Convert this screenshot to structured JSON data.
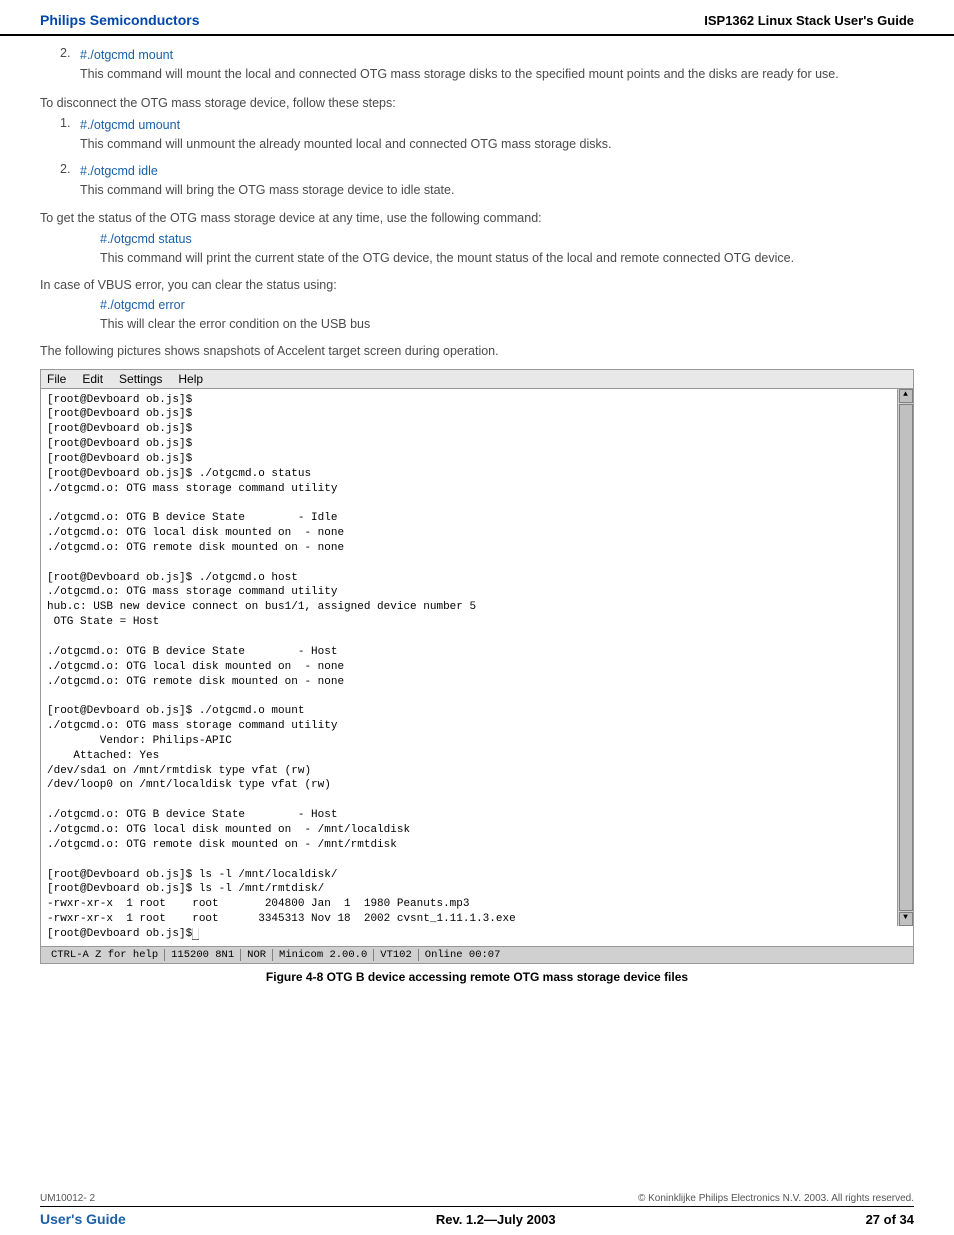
{
  "header": {
    "left": "Philips Semiconductors",
    "right": "ISP1362 Linux Stack User's Guide"
  },
  "content": {
    "item2_mount": {
      "number": "2.",
      "code": "#./otgcmd mount",
      "description": "This command will mount the local and connected OTG mass storage disks to the specified mount points and the disks are ready for use."
    },
    "disconnect_heading": "To disconnect the OTG mass storage device, follow these steps:",
    "disconnect_item1": {
      "number": "1.",
      "code": "#./otgcmd umount",
      "description": "This command will unmount the already mounted local and connected OTG mass storage disks."
    },
    "disconnect_item2": {
      "number": "2.",
      "code": "#./otgcmd idle",
      "description": "This command will bring the OTG mass storage device to idle state."
    },
    "status_heading": "To get the status of the OTG mass storage device at any time, use the following command:",
    "status_code": "#./otgcmd status",
    "status_description": "This command will print the current state of the OTG device, the mount status of the local and remote connected OTG device.",
    "vbus_heading": "In case of VBUS error, you can clear the status using:",
    "vbus_code": "#./otgcmd error",
    "vbus_description": "This will clear the error condition on the USB bus",
    "snapshot_intro": "The following pictures shows snapshots of Accelent target screen during operation.",
    "terminal": {
      "menu": [
        "File",
        "Edit",
        "Settings",
        "Help"
      ],
      "lines": [
        "[root@Devboard ob.js]$",
        "[root@Devboard ob.js]$",
        "[root@Devboard ob.js]$",
        "[root@Devboard ob.js]$",
        "[root@Devboard ob.js]$",
        "[root@Devboard ob.js]$ ./otgcmd.o status",
        "./otgcmd.o: OTG mass storage command utility",
        "",
        "./otgcmd.o: OTG B device State        - Idle",
        "./otgcmd.o: OTG local disk mounted on  - none",
        "./otgcmd.o: OTG remote disk mounted on - none",
        "",
        "[root@Devboard ob.js]$ ./otgcmd.o host",
        "./otgcmd.o: OTG mass storage command utility",
        "hub.c: USB new device connect on bus1/1, assigned device number 5",
        " OTG State = Host",
        "",
        "./otgcmd.o: OTG B device State        - Host",
        "./otgcmd.o: OTG local disk mounted on  - none",
        "./otgcmd.o: OTG remote disk mounted on - none",
        "",
        "[root@Devboard ob.js]$ ./otgcmd.o mount",
        "./otgcmd.o: OTG mass storage command utility",
        "        Vendor: Philips-APIC",
        "    Attached: Yes",
        "/dev/sda1 on /mnt/rmtdisk type vfat (rw)",
        "/dev/loop0 on /mnt/localdisk type vfat (rw)",
        "",
        "./otgcmd.o: OTG B device State        - Host",
        "./otgcmd.o: OTG local disk mounted on  - /mnt/localdisk",
        "./otgcmd.o: OTG remote disk mounted on - /mnt/rmtdisk",
        "",
        "[root@Devboard ob.js]$ ls -l /mnt/localdisk/",
        "[root@Devboard ob.js]$ ls -l /mnt/rmtdisk/",
        "-rwxr-xr-x  1 root    root       204800 Jan  1  1980 Peanuts.mp3",
        "-rwxr-xr-x  1 root    root      3345313 Nov 18  2002 cvsnt_1.11.1.3.exe",
        "[root@Devboard ob.js]$"
      ],
      "statusbar": [
        "CTRL-A Z for help",
        "115200 8N1",
        "NOR",
        "Minicom 2.00.0",
        "VT102",
        "Online 00:07"
      ]
    },
    "figure_caption": "Figure 4-8 OTG B device accessing remote OTG mass storage device files"
  },
  "footer": {
    "doc_id": "UM10012- 2",
    "copyright": "© Koninklijke Philips Electronics N.V. 2003. All rights reserved.",
    "guide_label": "User's Guide",
    "rev": "Rev. 1.2—July 2003",
    "page": "27 of 34"
  }
}
